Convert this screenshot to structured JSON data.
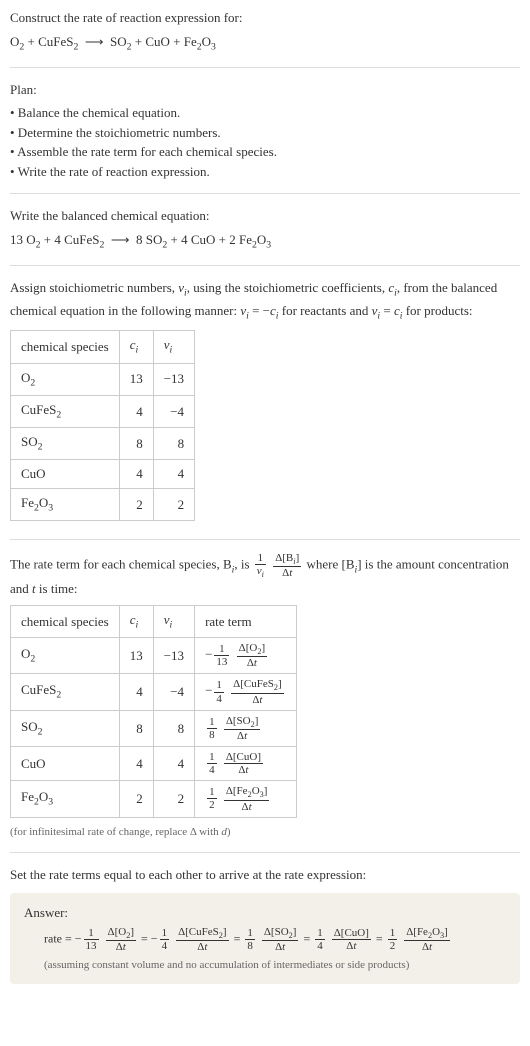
{
  "intro": {
    "title": "Construct the rate of reaction expression for:",
    "equation_html": "O<span class=\"sub\">2</span> + CuFeS<span class=\"sub\">2</span> &nbsp;⟶&nbsp; SO<span class=\"sub\">2</span> + CuO + Fe<span class=\"sub\">2</span>O<span class=\"sub\">3</span>"
  },
  "plan": {
    "heading": "Plan:",
    "items": [
      "• Balance the chemical equation.",
      "• Determine the stoichiometric numbers.",
      "• Assemble the rate term for each chemical species.",
      "• Write the rate of reaction expression."
    ]
  },
  "balanced": {
    "heading": "Write the balanced chemical equation:",
    "equation_html": "13 O<span class=\"sub\">2</span> + 4 CuFeS<span class=\"sub\">2</span> &nbsp;⟶&nbsp; 8 SO<span class=\"sub\">2</span> + 4 CuO + 2 Fe<span class=\"sub\">2</span>O<span class=\"sub\">3</span>"
  },
  "stoich": {
    "intro_html": "Assign stoichiometric numbers, <span class=\"ital\">ν<span class=\"sub\">i</span></span>, using the stoichiometric coefficients, <span class=\"ital\">c<span class=\"sub\">i</span></span>, from the balanced chemical equation in the following manner: <span class=\"ital\">ν<span class=\"sub\">i</span></span> = −<span class=\"ital\">c<span class=\"sub\">i</span></span> for reactants and <span class=\"ital\">ν<span class=\"sub\">i</span></span> = <span class=\"ital\">c<span class=\"sub\">i</span></span> for products:",
    "headers": {
      "species": "chemical species",
      "ci_html": "<span class=\"ital\">c<span class=\"sub\">i</span></span>",
      "vi_html": "<span class=\"ital\">ν<span class=\"sub\">i</span></span>"
    },
    "rows": [
      {
        "species_html": "O<span class=\"sub\">2</span>",
        "ci": "13",
        "vi": "−13"
      },
      {
        "species_html": "CuFeS<span class=\"sub\">2</span>",
        "ci": "4",
        "vi": "−4"
      },
      {
        "species_html": "SO<span class=\"sub\">2</span>",
        "ci": "8",
        "vi": "8"
      },
      {
        "species_html": "CuO",
        "ci": "4",
        "vi": "4"
      },
      {
        "species_html": "Fe<span class=\"sub\">2</span>O<span class=\"sub\">3</span>",
        "ci": "2",
        "vi": "2"
      }
    ]
  },
  "rate_terms": {
    "intro_html": "The rate term for each chemical species, B<span class=\"sub ital\">i</span>, is <span class=\"frac\"><span class=\"num\">1</span><span class=\"den ital\">ν<span class=\"sub\">i</span></span></span> <span class=\"frac\"><span class=\"num\">Δ[B<span class=\"sub ital\">i</span>]</span><span class=\"den\">Δ<span class=\"ital\">t</span></span></span> where [B<span class=\"sub ital\">i</span>] is the amount concentration and <span class=\"ital\">t</span> is time:",
    "headers": {
      "species": "chemical species",
      "ci_html": "<span class=\"ital\">c<span class=\"sub\">i</span></span>",
      "vi_html": "<span class=\"ital\">ν<span class=\"sub\">i</span></span>",
      "rate": "rate term"
    },
    "rows": [
      {
        "species_html": "O<span class=\"sub\">2</span>",
        "ci": "13",
        "vi": "−13",
        "rate_html": "−<span class=\"frac small\"><span class=\"num\">1</span><span class=\"den\">13</span></span> <span class=\"frac small\"><span class=\"num\">Δ[O<span class=\"sub\">2</span>]</span><span class=\"den\">Δ<span class=\"ital\">t</span></span></span>"
      },
      {
        "species_html": "CuFeS<span class=\"sub\">2</span>",
        "ci": "4",
        "vi": "−4",
        "rate_html": "−<span class=\"frac small\"><span class=\"num\">1</span><span class=\"den\">4</span></span> <span class=\"frac small\"><span class=\"num\">Δ[CuFeS<span class=\"sub\">2</span>]</span><span class=\"den\">Δ<span class=\"ital\">t</span></span></span>"
      },
      {
        "species_html": "SO<span class=\"sub\">2</span>",
        "ci": "8",
        "vi": "8",
        "rate_html": "<span class=\"frac small\"><span class=\"num\">1</span><span class=\"den\">8</span></span> <span class=\"frac small\"><span class=\"num\">Δ[SO<span class=\"sub\">2</span>]</span><span class=\"den\">Δ<span class=\"ital\">t</span></span></span>"
      },
      {
        "species_html": "CuO",
        "ci": "4",
        "vi": "4",
        "rate_html": "<span class=\"frac small\"><span class=\"num\">1</span><span class=\"den\">4</span></span> <span class=\"frac small\"><span class=\"num\">Δ[CuO]</span><span class=\"den\">Δ<span class=\"ital\">t</span></span></span>"
      },
      {
        "species_html": "Fe<span class=\"sub\">2</span>O<span class=\"sub\">3</span>",
        "ci": "2",
        "vi": "2",
        "rate_html": "<span class=\"frac small\"><span class=\"num\">1</span><span class=\"den\">2</span></span> <span class=\"frac small\"><span class=\"num\">Δ[Fe<span class=\"sub\">2</span>O<span class=\"sub\">3</span>]</span><span class=\"den\">Δ<span class=\"ital\">t</span></span></span>"
      }
    ],
    "footnote_html": "(for infinitesimal rate of change, replace Δ with <span class=\"ital\">d</span>)"
  },
  "final": {
    "heading": "Set the rate terms equal to each other to arrive at the rate expression:",
    "answer_label": "Answer:",
    "rate_html": "rate = −<span class=\"frac small\"><span class=\"num\">1</span><span class=\"den\">13</span></span> <span class=\"frac small\"><span class=\"num\">Δ[O<span class=\"sub\">2</span>]</span><span class=\"den\">Δ<span class=\"ital\">t</span></span></span> = −<span class=\"frac small\"><span class=\"num\">1</span><span class=\"den\">4</span></span> <span class=\"frac small\"><span class=\"num\">Δ[CuFeS<span class=\"sub\">2</span>]</span><span class=\"den\">Δ<span class=\"ital\">t</span></span></span> = <span class=\"frac small\"><span class=\"num\">1</span><span class=\"den\">8</span></span> <span class=\"frac small\"><span class=\"num\">Δ[SO<span class=\"sub\">2</span>]</span><span class=\"den\">Δ<span class=\"ital\">t</span></span></span> = <span class=\"frac small\"><span class=\"num\">1</span><span class=\"den\">4</span></span> <span class=\"frac small\"><span class=\"num\">Δ[CuO]</span><span class=\"den\">Δ<span class=\"ital\">t</span></span></span> = <span class=\"frac small\"><span class=\"num\">1</span><span class=\"den\">2</span></span> <span class=\"frac small\"><span class=\"num\">Δ[Fe<span class=\"sub\">2</span>O<span class=\"sub\">3</span>]</span><span class=\"den\">Δ<span class=\"ital\">t</span></span></span>",
    "assumption": "(assuming constant volume and no accumulation of intermediates or side products)"
  }
}
